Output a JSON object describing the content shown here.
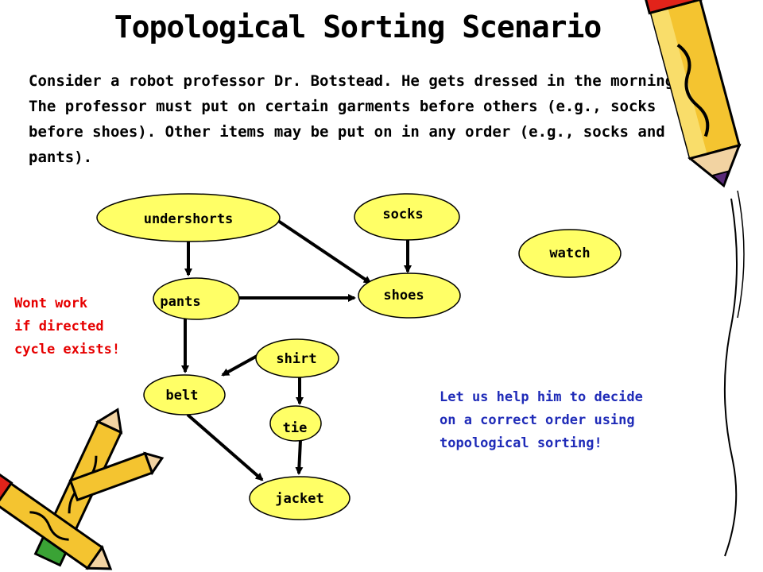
{
  "title": "Topological Sorting Scenario",
  "intro": "Consider a robot professor Dr. Botstead. He gets dressed in the morning. The professor must put on certain garments before others (e.g., socks before shoes). Other items may be put on in any order (e.g., socks and pants).",
  "nodes": {
    "undershorts": "undershorts",
    "socks": "socks",
    "watch": "watch",
    "pants": "pants",
    "shoes": "shoes",
    "shirt": "shirt",
    "belt": "belt",
    "tie": "tie",
    "jacket": "jacket"
  },
  "edges": [
    [
      "undershorts",
      "pants"
    ],
    [
      "undershorts",
      "shoes"
    ],
    [
      "socks",
      "shoes"
    ],
    [
      "pants",
      "shoes"
    ],
    [
      "pants",
      "belt"
    ],
    [
      "shirt",
      "belt"
    ],
    [
      "shirt",
      "tie"
    ],
    [
      "tie",
      "jacket"
    ],
    [
      "belt",
      "jacket"
    ]
  ],
  "warning": "Wont work\nif directed\ncycle exists!",
  "note": "Let us help him to decide\non a correct order using\ntopological sorting!",
  "colors": {
    "node_fill": "#ffff66",
    "node_stroke": "#000000",
    "edge": "#000000",
    "warning": "#e60000",
    "note": "#1f2bb8"
  }
}
